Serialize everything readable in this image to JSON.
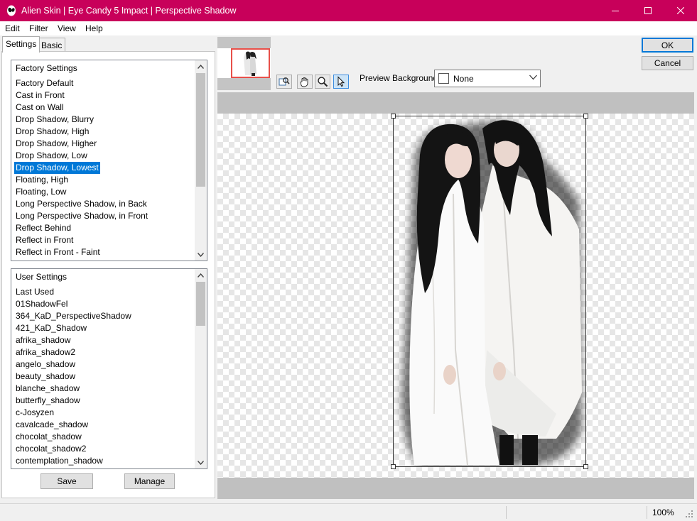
{
  "window": {
    "title": "Alien Skin | Eye Candy 5 Impact | Perspective Shadow",
    "accent_color": "#c8005a"
  },
  "menu": [
    "Edit",
    "Filter",
    "View",
    "Help"
  ],
  "tabs": [
    {
      "label": "Settings",
      "active": true
    },
    {
      "label": "Basic",
      "active": false
    }
  ],
  "factory_settings": {
    "header": "Factory Settings",
    "items": [
      "Factory Default",
      "Cast in Front",
      "Cast on Wall",
      "Drop Shadow, Blurry",
      "Drop Shadow, High",
      "Drop Shadow, Higher",
      "Drop Shadow, Low",
      "Drop Shadow, Lowest",
      "Floating, High",
      "Floating, Low",
      "Long Perspective Shadow, in Back",
      "Long Perspective Shadow, in Front",
      "Reflect Behind",
      "Reflect in Front",
      "Reflect in Front - Faint"
    ],
    "selected": "Drop Shadow, Lowest"
  },
  "user_settings": {
    "header": "User Settings",
    "items": [
      "Last Used",
      "01ShadowFel",
      "364_KaD_PerspectiveShadow",
      "421_KaD_Shadow",
      "afrika_shadow",
      "afrika_shadow2",
      "angelo_shadow",
      "beauty_shadow",
      "blanche_shadow",
      "butterfly_shadow",
      "c-Josyzen",
      "cavalcade_shadow",
      "chocolat_shadow",
      "chocolat_shadow2",
      "contemplation_shadow"
    ]
  },
  "buttons": {
    "save": "Save",
    "manage": "Manage",
    "ok": "OK",
    "cancel": "Cancel"
  },
  "preview": {
    "background_label": "Preview Background:",
    "background_value": "None",
    "tools": [
      "navigate-icon",
      "hand-icon",
      "zoom-icon",
      "pointer-icon"
    ],
    "active_tool": "pointer-icon"
  },
  "status": {
    "zoom": "100%"
  }
}
